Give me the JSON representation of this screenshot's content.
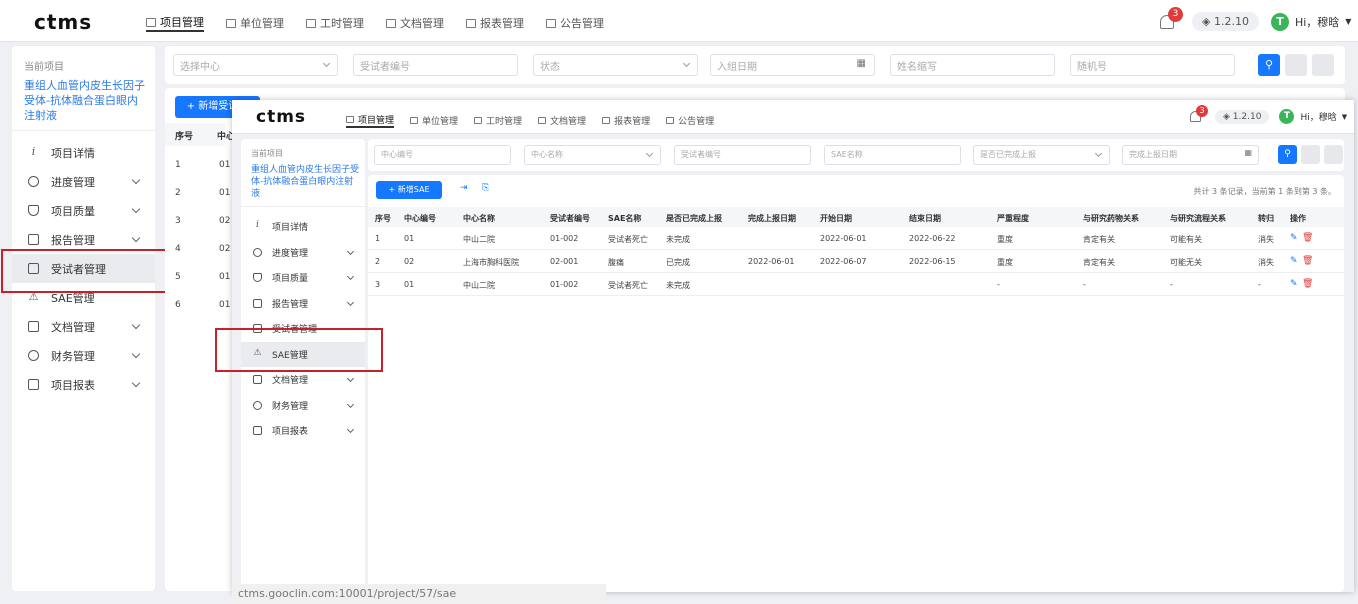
{
  "app": {
    "logo": "ctms",
    "version": "1.2.10",
    "user": "Hi，穆晗",
    "avatar_letter": "T",
    "notif_count": "3"
  },
  "nav": [
    "项目管理",
    "单位管理",
    "工时管理",
    "文档管理",
    "报表管理",
    "公告管理"
  ],
  "sidebar": {
    "label": "当前项目",
    "project": "重组人血管内皮生长因子受体-抗体融合蛋白眼内注射液",
    "items": [
      "项目详情",
      "进度管理",
      "项目质量",
      "报告管理",
      "受试者管理",
      "SAE管理",
      "文档管理",
      "财务管理",
      "项目报表"
    ]
  },
  "bg": {
    "filters": [
      "选择中心",
      "受试者编号",
      "状态",
      "入组日期",
      "姓名缩写",
      "随机号"
    ],
    "add_btn": "+ 新增受试者",
    "col_headers": [
      "序号",
      "中心"
    ],
    "rows": [
      [
        "1",
        "01"
      ],
      [
        "2",
        "01"
      ],
      [
        "3",
        "02"
      ],
      [
        "4",
        "02"
      ],
      [
        "5",
        "01"
      ],
      [
        "6",
        "01"
      ]
    ]
  },
  "fg": {
    "nav": [
      "项目管理",
      "单位管理",
      "工时管理",
      "文档管理",
      "报表管理",
      "公告管理"
    ],
    "version": "1.2.10",
    "user": "Hi，穆晗",
    "notif_count": "3",
    "sidebar_items": [
      "项目详情",
      "进度管理",
      "项目质量",
      "报告管理",
      "受试者管理",
      "SAE管理",
      "文档管理",
      "财务管理",
      "项目报表"
    ],
    "filters": [
      "中心编号",
      "中心名称",
      "受试者编号",
      "SAE名称",
      "是否已完成上报",
      "完成上报日期"
    ],
    "add_btn": "+ 新增SAE",
    "summary": "共计 3 条记录，当前第 1 条到第 3 条。",
    "headers": [
      "序号",
      "中心编号",
      "中心名称",
      "受试者编号",
      "SAE名称",
      "是否已完成上报",
      "完成上报日期",
      "开始日期",
      "结束日期",
      "严重程度",
      "与研究药物关系",
      "与研究流程关系",
      "转归",
      "操作"
    ],
    "rows": [
      [
        "1",
        "01",
        "中山二院",
        "01-002",
        "受试者死亡",
        "未完成",
        "",
        "2022-06-01",
        "2022-06-22",
        "重度",
        "肯定有关",
        "可能有关",
        "消失"
      ],
      [
        "2",
        "02",
        "上海市胸科医院",
        "02-001",
        "腹痛",
        "已完成",
        "2022-06-01",
        "2022-06-07",
        "2022-06-15",
        "重度",
        "肯定有关",
        "可能无关",
        "消失"
      ],
      [
        "3",
        "01",
        "中山二院",
        "01-002",
        "受试者死亡",
        "未完成",
        "",
        "",
        "",
        "-",
        "-",
        "-",
        "-"
      ]
    ]
  },
  "status_url": "ctms.gooclin.com:10001/project/57/sae",
  "colors": {
    "accent": "#1677ff",
    "highlight": "#c8202a",
    "link": "#2c7be5"
  }
}
